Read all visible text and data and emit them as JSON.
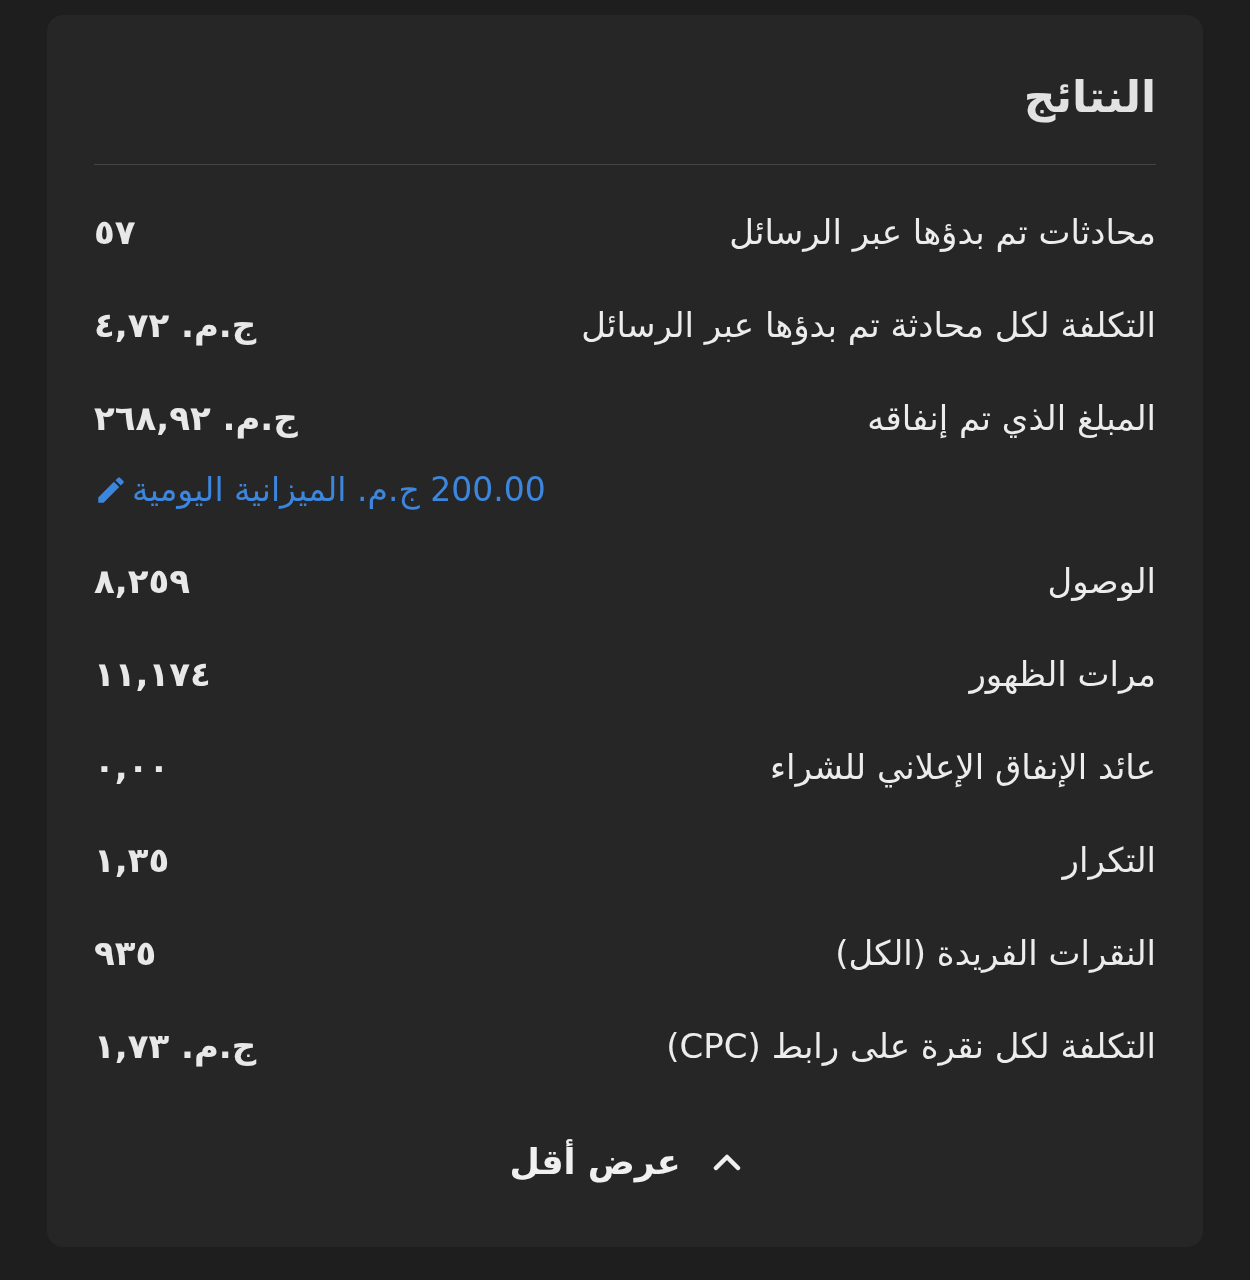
{
  "title": "النتائج",
  "metrics": [
    {
      "label": "محادثات تم بدؤها عبر الرسائل",
      "value": "٥٧"
    },
    {
      "label": "التكلفة لكل محادثة تم بدؤها عبر الرسائل",
      "value": "ج.م. ٤,٧٢"
    },
    {
      "label": "المبلغ الذي تم إنفاقه",
      "value": "ج.م. ٢٦٨,٩٢",
      "budget_link": "200.00 ج.م. الميزانية اليومية"
    },
    {
      "label": "الوصول",
      "value": "٨,٢٥٩"
    },
    {
      "label": "مرات الظهور",
      "value": "١١,١٧٤"
    },
    {
      "label": "عائد الإنفاق الإعلاني للشراء",
      "value": "٠,٠٠"
    },
    {
      "label": "التكرار",
      "value": "١,٣٥"
    },
    {
      "label": "النقرات الفريدة (الكل)",
      "value": "٩٣٥"
    },
    {
      "label": "التكلفة لكل نقرة على رابط (CPC)",
      "value": "ج.م. ١,٧٣"
    }
  ],
  "toggle": {
    "label": "عرض أقل",
    "expanded": true
  }
}
